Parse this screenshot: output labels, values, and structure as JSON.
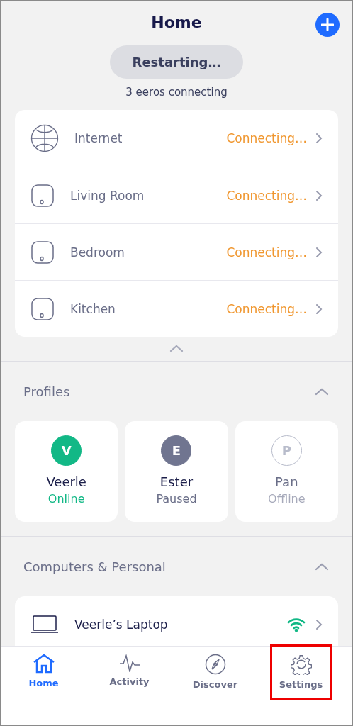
{
  "header": {
    "title": "Home",
    "status_button": "Restarting…",
    "status_text": "3 eeros connecting"
  },
  "network": [
    {
      "kind": "internet",
      "name": "Internet",
      "status": "Connecting…"
    },
    {
      "kind": "eero",
      "name": "Living Room",
      "status": "Connecting…"
    },
    {
      "kind": "eero",
      "name": "Bedroom",
      "status": "Connecting…"
    },
    {
      "kind": "eero",
      "name": "Kitchen",
      "status": "Connecting…"
    }
  ],
  "profiles": {
    "title": "Profiles",
    "expanded": true,
    "items": [
      {
        "initial": "V",
        "name": "Veerle",
        "status": "Online",
        "kind": "online",
        "color": "#12b886"
      },
      {
        "initial": "E",
        "name": "Ester",
        "status": "Paused",
        "kind": "paused",
        "color": "#707590"
      },
      {
        "initial": "P",
        "name": "Pan",
        "status": "Offline",
        "kind": "offline",
        "color": "#b8bccb"
      }
    ]
  },
  "devices": {
    "title": "Computers & Personal",
    "expanded": true,
    "items": [
      {
        "kind": "laptop",
        "name": "Veerle’s Laptop",
        "wifi": true
      }
    ]
  },
  "nav": [
    {
      "kind": "home",
      "label": "Home",
      "selected": true,
      "highlighted": false
    },
    {
      "kind": "activity",
      "label": "Activity",
      "selected": false,
      "highlighted": false
    },
    {
      "kind": "discover",
      "label": "Discover",
      "selected": false,
      "highlighted": false
    },
    {
      "kind": "settings",
      "label": "Settings",
      "selected": false,
      "highlighted": true
    }
  ]
}
